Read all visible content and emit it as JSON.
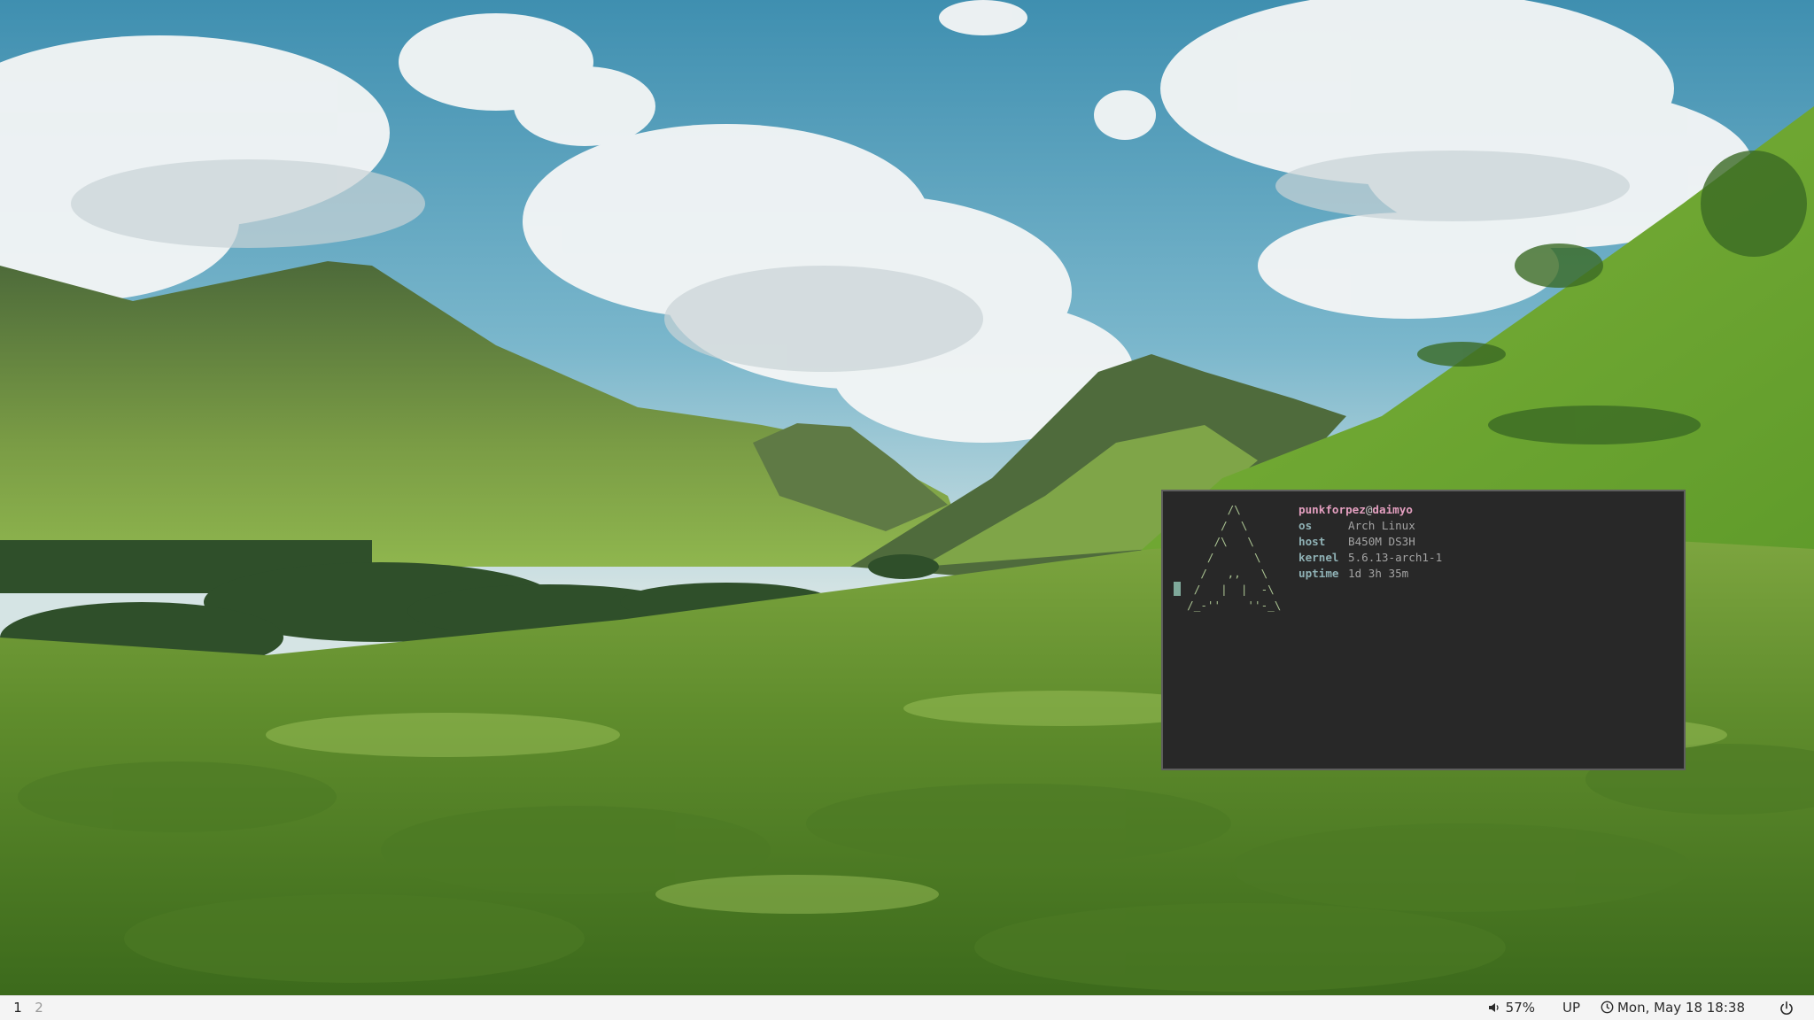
{
  "terminal": {
    "logo": "        /\\\n       /  \\\n      /\\   \\\n     /      \\\n    /   ,,   \\\n   /   |  |  -\\\n  /_-''    ''-_\\",
    "user": "punkforpez",
    "at": "@",
    "hostname": "daimyo",
    "rows": [
      {
        "key": "os",
        "value": "Arch Linux"
      },
      {
        "key": "host",
        "value": "B450M DS3H"
      },
      {
        "key": "kernel",
        "value": "5.6.13-arch1-1"
      },
      {
        "key": "uptime",
        "value": "1d 3h 35m"
      }
    ]
  },
  "bar": {
    "workspaces": [
      "1",
      "2"
    ],
    "active_workspace": "1",
    "volume": "57%",
    "network": "UP",
    "datetime": "Mon, May 18 18:38"
  },
  "icons": {
    "volume": "speaker-icon",
    "clock": "clock-icon",
    "power": "power-icon"
  }
}
